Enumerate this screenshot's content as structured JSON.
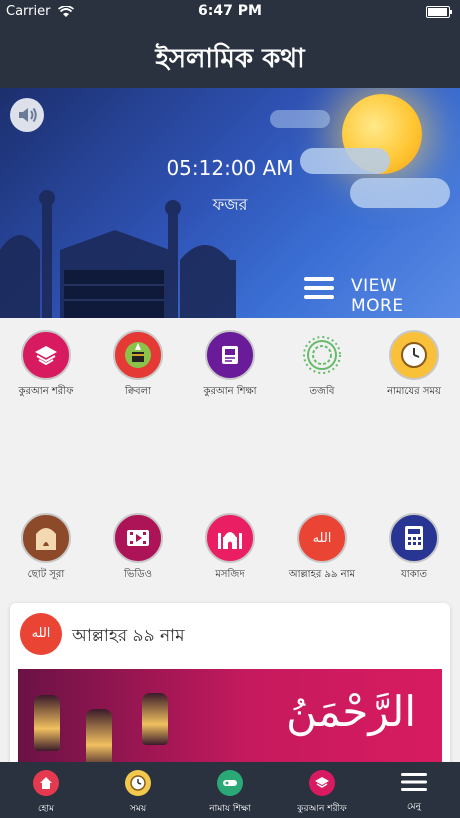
{
  "status_bar": {
    "carrier": "Carrier",
    "time": "6:47 PM"
  },
  "header": {
    "title": "ইসলামিক কথা"
  },
  "hero": {
    "clock": "05:12:00 AM",
    "prayer_name": "ফজর",
    "view_more": "VIEW MORE"
  },
  "grid_row1": [
    {
      "label": "কুরআন শরীফ",
      "icon": "quran-book-icon",
      "color": "#d81b60"
    },
    {
      "label": "ক্বিবলা",
      "icon": "qibla-kaaba-icon",
      "color": "#e53935"
    },
    {
      "label": "কুরআন শিক্ষা",
      "icon": "quran-learning-icon",
      "color": "#6a1b9a"
    },
    {
      "label": "তজবি",
      "icon": "tasbih-beads-icon",
      "color": "#66bb6a"
    },
    {
      "label": "নামাযের সময়",
      "icon": "prayer-clock-icon",
      "color": "#f9c13a"
    }
  ],
  "grid_row2": [
    {
      "label": "ছোট সূরা",
      "icon": "short-surah-icon",
      "color": "#8d4a2a"
    },
    {
      "label": "ভিডিও",
      "icon": "video-film-icon",
      "color": "#ad1457"
    },
    {
      "label": "মসজিদ",
      "icon": "mosque-icon",
      "color": "#e91e63"
    },
    {
      "label": "আল্লাহর ৯৯ নাম",
      "icon": "allah-names-icon",
      "color": "#e94434"
    },
    {
      "label": "যাকাত",
      "icon": "zakat-calculator-icon",
      "color": "#283593"
    }
  ],
  "card": {
    "title": "আল্লাহর ৯৯ নাম",
    "icon_text": "الله",
    "banner_text": "الرَّحْمَنُ"
  },
  "tabbar": [
    {
      "label": "হোম",
      "icon": "home-icon",
      "color": "#e53950"
    },
    {
      "label": "সময়",
      "icon": "clock-icon",
      "color": "#f2c94c"
    },
    {
      "label": "নামায শিক্ষা",
      "icon": "prayer-learning-icon",
      "color": "#2aa876"
    },
    {
      "label": "কুরআন শরীফ",
      "icon": "quran-icon",
      "color": "#d81b60"
    },
    {
      "label": "মেনু",
      "icon": "menu-icon",
      "color": "#ffffff"
    }
  ]
}
